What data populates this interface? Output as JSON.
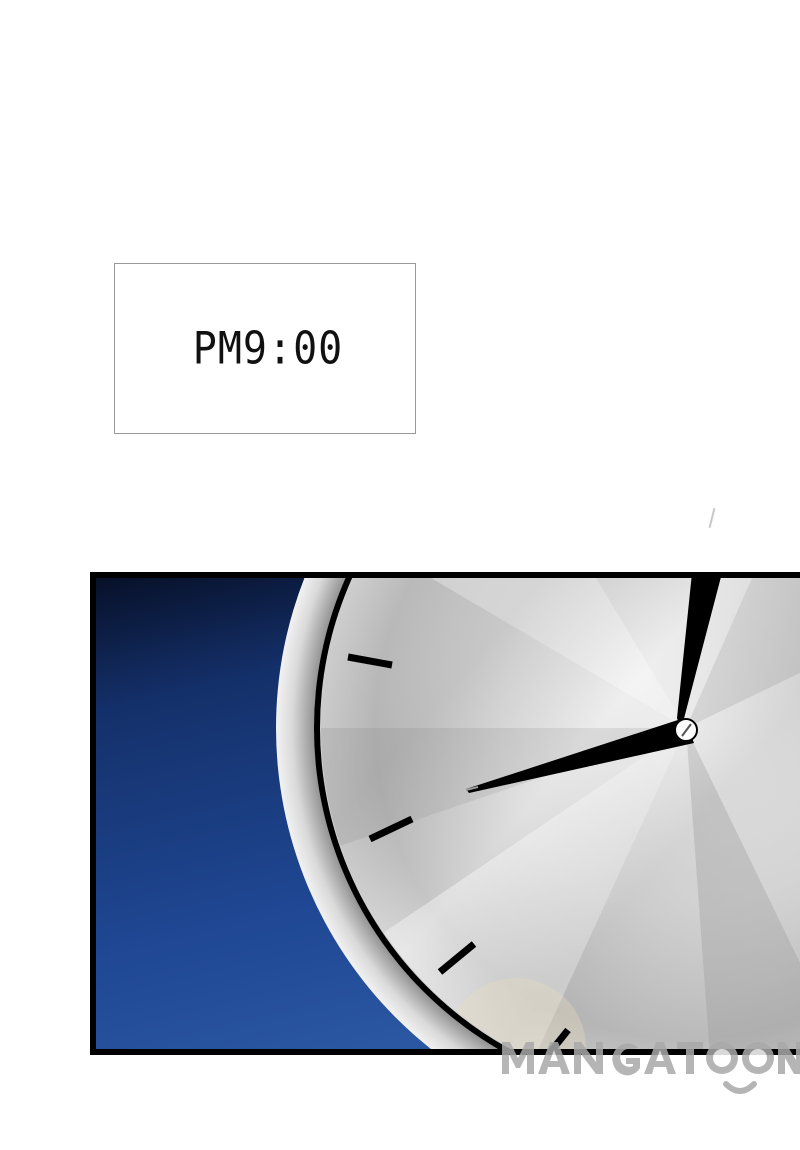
{
  "caption": {
    "time_text": "PM9:00"
  },
  "illustration": {
    "subject": "wall-clock-face",
    "background_color": "#1c3f86",
    "clock_face_color": "#cfcfcf",
    "hand_color": "#000000"
  },
  "watermark": {
    "logo": "MANGATOON"
  }
}
